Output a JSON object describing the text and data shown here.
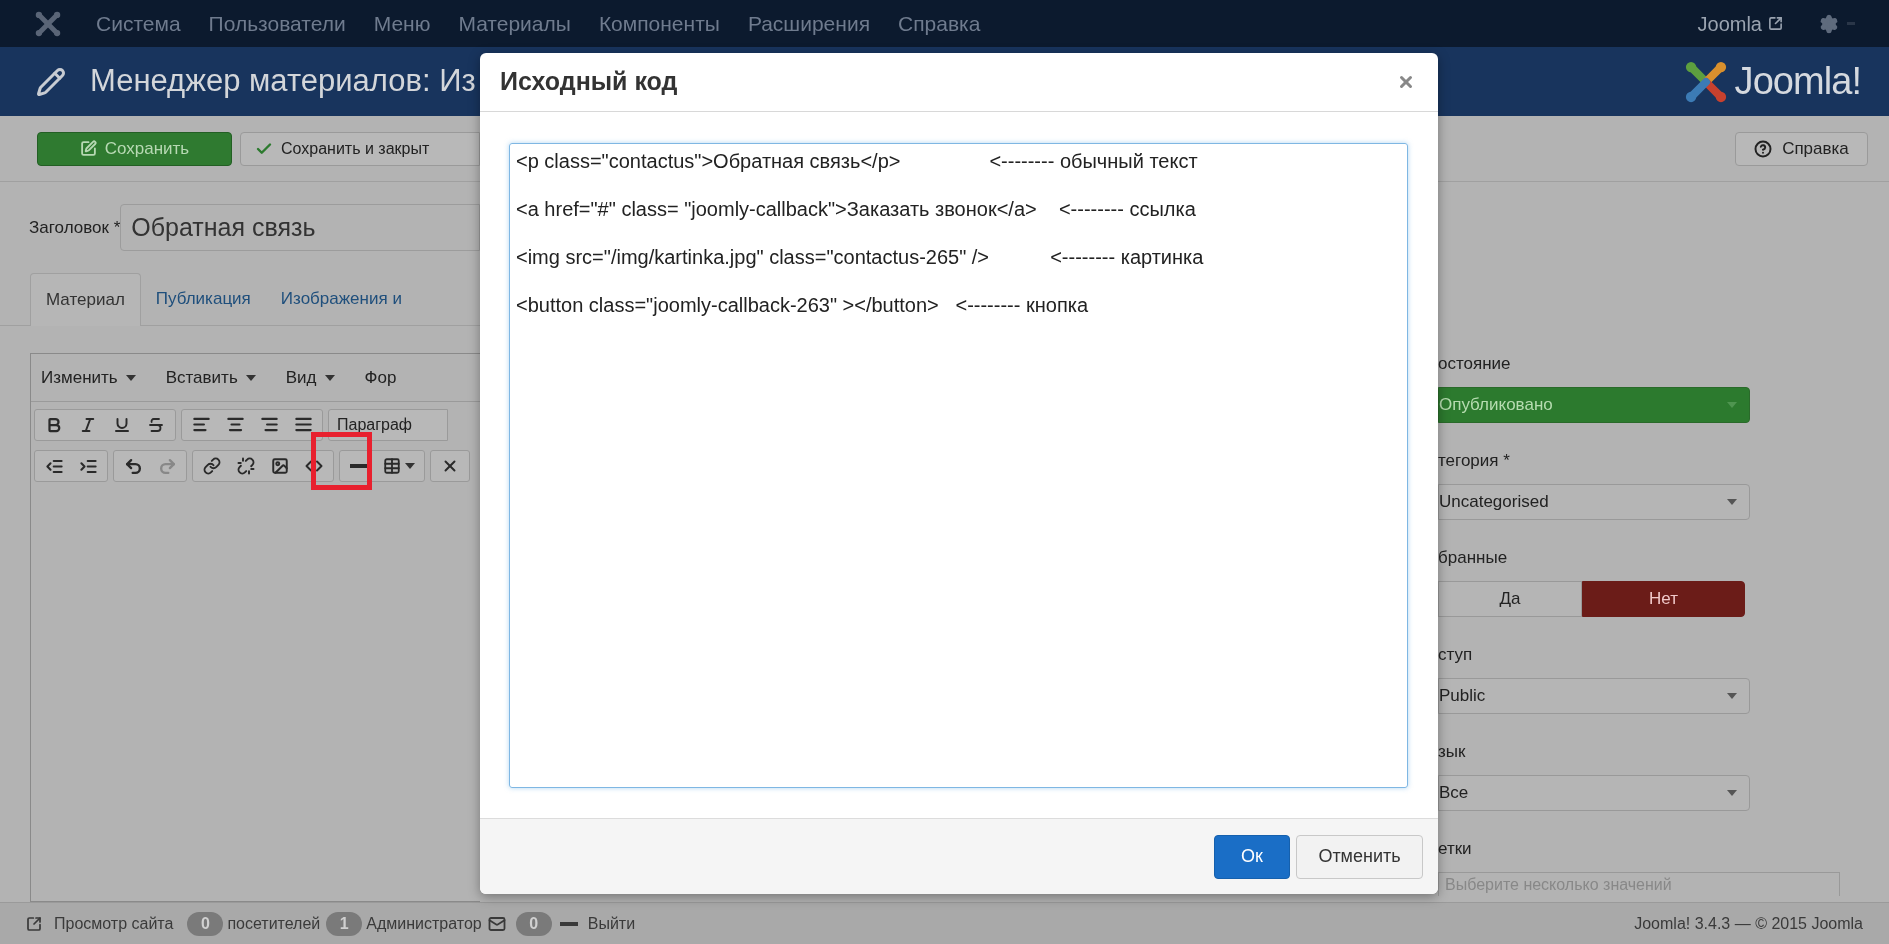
{
  "top_menu": {
    "items": [
      "Система",
      "Пользователи",
      "Меню",
      "Материалы",
      "Компоненты",
      "Расширения",
      "Справка"
    ],
    "site_link": "Joomla"
  },
  "header": {
    "title": "Менеджер материалов: Из",
    "logo_text": "Joomla!"
  },
  "toolbar": {
    "buttons": [
      {
        "label": "Сохранить",
        "kind": "primary"
      },
      {
        "label": "Сохранить и закрыт",
        "kind": "check"
      }
    ],
    "help": "Справка"
  },
  "form": {
    "title_label": "Заголовок *",
    "title_value": "Обратная связь",
    "tabs": [
      {
        "label": "Материал",
        "selected": true
      },
      {
        "label": "Публикация",
        "selected": false
      },
      {
        "label": "Изображения и",
        "selected": false
      }
    ]
  },
  "editor": {
    "menus": [
      {
        "label": "Изменить",
        "caret": true
      },
      {
        "label": "Вставить",
        "caret": true
      },
      {
        "label": "Вид",
        "caret": true
      },
      {
        "label": "Фор",
        "caret": false
      }
    ],
    "format_select": "Параграф"
  },
  "sidebar": {
    "fields": [
      {
        "label": "остояние",
        "kind": "status-select",
        "value": "Опубликовано"
      },
      {
        "label": "тегория *",
        "kind": "select",
        "value": "Uncategorised"
      },
      {
        "label": "бранные",
        "kind": "toggle",
        "options": [
          {
            "label": "Да",
            "selected": false
          },
          {
            "label": "Нет",
            "selected": true
          }
        ]
      },
      {
        "label": "ступ",
        "kind": "select",
        "value": "Public"
      },
      {
        "label": "зык",
        "kind": "select",
        "value": "Все"
      },
      {
        "label": "етки",
        "kind": "tags",
        "placeholder": "Выберите несколько значений"
      }
    ]
  },
  "dialog": {
    "title": "Исходный код",
    "code_lines": [
      "<p class=\"contactus\">Обратная связь</p>                <-------- обычный текст",
      "<a href=\"#\" class= \"joomly-callback\">Заказать звонок</a>    <-------- ссылка",
      "<img src=\"/img/kartinka.jpg\" class=\"contactus-265\" />           <-------- картинка",
      "<button class=\"joomly-callback-263\" ></button>   <-------- кнопка"
    ],
    "buttons": [
      {
        "label": "Ок",
        "kind": "primary"
      },
      {
        "label": "Отменить",
        "kind": "default"
      }
    ]
  },
  "status_bar": {
    "view_site": "Просмотр сайта",
    "visitors_count": "0",
    "visitors_label": "посетителей",
    "admins_count": "1",
    "admins_label": "Администратор",
    "messages_count": "0",
    "logout": "Выйти",
    "version": "Joomla! 3.4.3 — © 2015 Joomla"
  }
}
